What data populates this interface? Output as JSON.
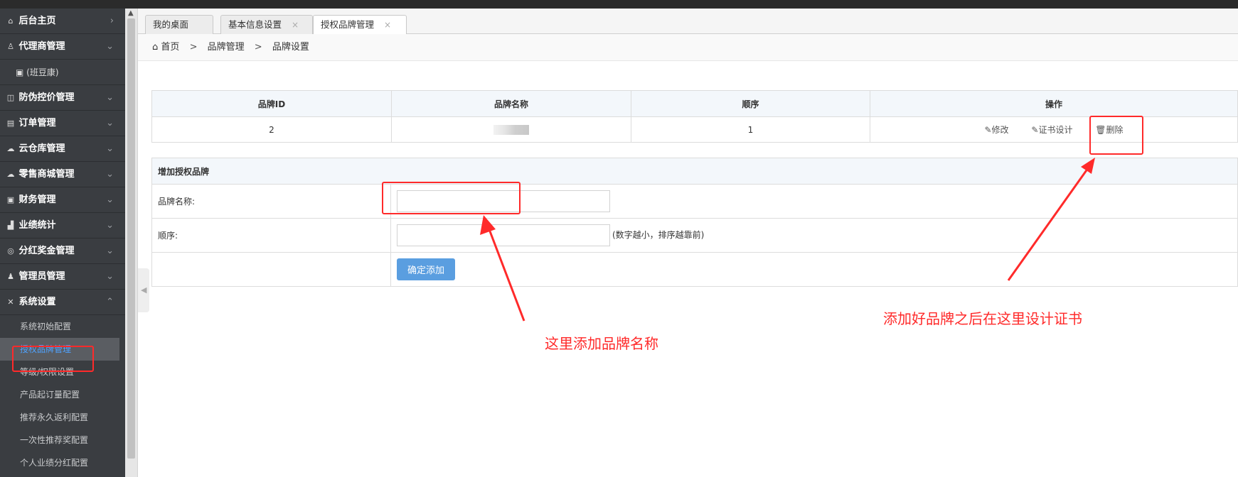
{
  "sidebar": {
    "menu": [
      {
        "icon": "home-icon",
        "glyph": "⌂",
        "label": "后台主页",
        "chevron": "›"
      },
      {
        "icon": "user-icon",
        "glyph": "♙",
        "label": "代理商管理",
        "chevron": "⌄"
      },
      {
        "icon": "id-card-icon",
        "glyph": "▣",
        "label": "(班豆康)",
        "sub": true
      },
      {
        "icon": "shield-icon",
        "glyph": "◫",
        "label": "防伪控价管理",
        "chevron": "⌄"
      },
      {
        "icon": "order-icon",
        "glyph": "▤",
        "label": "订单管理",
        "chevron": "⌄"
      },
      {
        "icon": "cloud-icon",
        "glyph": "☁",
        "label": "云仓库管理",
        "chevron": "⌄"
      },
      {
        "icon": "cloud-icon",
        "glyph": "☁",
        "label": "零售商城管理",
        "chevron": "⌄"
      },
      {
        "icon": "finance-icon",
        "glyph": "▣",
        "label": "财务管理",
        "chevron": "⌄"
      },
      {
        "icon": "bar-chart-icon",
        "glyph": "▟",
        "label": "业绩统计",
        "chevron": "⌄"
      },
      {
        "icon": "database-icon",
        "glyph": "◎",
        "label": "分红奖金管理",
        "chevron": "⌄"
      },
      {
        "icon": "admin-icon",
        "glyph": "♟",
        "label": "管理员管理",
        "chevron": "⌄"
      },
      {
        "icon": "wrench-icon",
        "glyph": "✕",
        "label": "系统设置",
        "chevron": "⌃"
      }
    ],
    "submenu": [
      {
        "label": "系统初始配置",
        "active": false
      },
      {
        "label": "授权品牌管理",
        "active": true
      },
      {
        "label": "等级/权限设置",
        "active": false
      },
      {
        "label": "产品起订量配置",
        "active": false
      },
      {
        "label": "推荐永久返利配置",
        "active": false
      },
      {
        "label": "一次性推荐奖配置",
        "active": false
      },
      {
        "label": "个人业绩分红配置",
        "active": false
      }
    ]
  },
  "tabs": [
    {
      "label": "我的桌面",
      "closable": false,
      "active": false
    },
    {
      "label": "基本信息设置",
      "closable": true,
      "active": false
    },
    {
      "label": "授权品牌管理",
      "closable": true,
      "active": true
    }
  ],
  "breadcrumb": {
    "home": "首页",
    "sep": ">",
    "level1": "品牌管理",
    "level2": "品牌设置"
  },
  "brand_table": {
    "headers": [
      "品牌ID",
      "品牌名称",
      "顺序",
      "操作"
    ],
    "rows": [
      {
        "id": "2",
        "order": "1"
      }
    ],
    "actions": {
      "edit": "修改",
      "cert": "证书设计",
      "delete": "删除"
    }
  },
  "add_form": {
    "title": "增加授权品牌",
    "name_label": "品牌名称:",
    "name_value": "",
    "order_label": "顺序:",
    "order_value": "",
    "order_hint": "(数字越小，排序越靠前)",
    "submit_label": "确定添加"
  },
  "annotations": {
    "add_name": "这里添加品牌名称",
    "design_cert": "添加好品牌之后在这里设计证书",
    "color": "#ff2a2a"
  }
}
